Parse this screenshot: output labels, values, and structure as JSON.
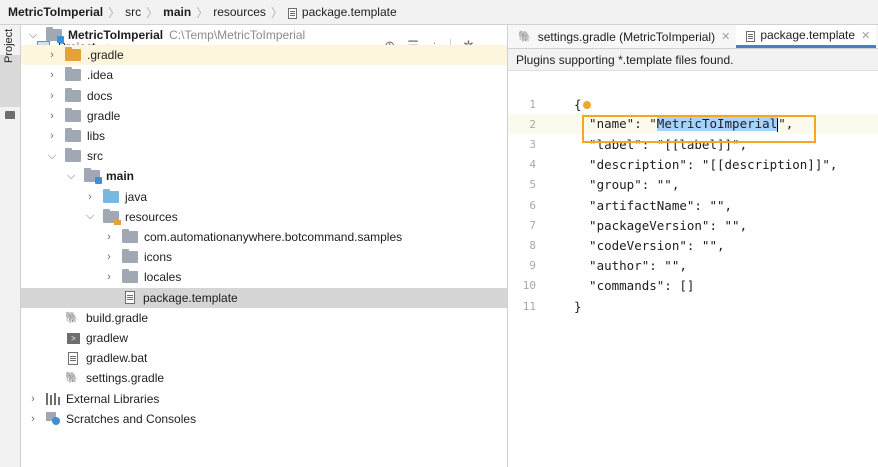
{
  "breadcrumb": [
    "MetricToImperial",
    "src",
    "main",
    "resources",
    "package.template"
  ],
  "toolstrip": {
    "label": "Project"
  },
  "project_panel": {
    "title": "Project"
  },
  "tree": [
    {
      "label": "MetricToImperial",
      "hint": "C:\\Temp\\MetricToImperial",
      "icon": "module",
      "arrow": "down",
      "indent": 0,
      "bold": true
    },
    {
      "label": ".gradle",
      "icon": "orange",
      "arrow": "right",
      "indent": 1,
      "highlight": "yellow"
    },
    {
      "label": ".idea",
      "icon": "folder",
      "arrow": "right",
      "indent": 1
    },
    {
      "label": "docs",
      "icon": "folder",
      "arrow": "right",
      "indent": 1
    },
    {
      "label": "gradle",
      "icon": "folder",
      "arrow": "right",
      "indent": 1
    },
    {
      "label": "libs",
      "icon": "folder",
      "arrow": "right",
      "indent": 1
    },
    {
      "label": "src",
      "icon": "folder",
      "arrow": "down",
      "indent": 1
    },
    {
      "label": "main",
      "icon": "module",
      "arrow": "down",
      "indent": 2,
      "bold": true
    },
    {
      "label": "java",
      "icon": "blue",
      "arrow": "right",
      "indent": 3
    },
    {
      "label": "resources",
      "icon": "res",
      "arrow": "down",
      "indent": 3
    },
    {
      "label": "com.automationanywhere.botcommand.samples",
      "icon": "folder",
      "arrow": "right",
      "indent": 4
    },
    {
      "label": "icons",
      "icon": "folder",
      "arrow": "right",
      "indent": 4
    },
    {
      "label": "locales",
      "icon": "folder",
      "arrow": "right",
      "indent": 4
    },
    {
      "label": "package.template",
      "icon": "file",
      "arrow": "none",
      "indent": 4,
      "highlight": "gray"
    },
    {
      "label": "build.gradle",
      "icon": "gradle",
      "arrow": "none",
      "indent": 1
    },
    {
      "label": "gradlew",
      "icon": "term",
      "arrow": "none",
      "indent": 1
    },
    {
      "label": "gradlew.bat",
      "icon": "file",
      "arrow": "none",
      "indent": 1
    },
    {
      "label": "settings.gradle",
      "icon": "gradle",
      "arrow": "none",
      "indent": 1
    },
    {
      "label": "External Libraries",
      "icon": "lib",
      "arrow": "right",
      "indent": 0
    },
    {
      "label": "Scratches and Consoles",
      "icon": "scratch",
      "arrow": "right",
      "indent": 0
    }
  ],
  "editor": {
    "tabs": [
      {
        "label": "settings.gradle (MetricToImperial)",
        "active": false
      },
      {
        "label": "package.template",
        "active": true
      }
    ],
    "banner": "Plugins supporting *.template files found.",
    "lines": [
      {
        "num": "1",
        "text": "{"
      },
      {
        "num": "2",
        "pre": "  \"name\": \"",
        "selected": "MetricToImperia",
        "tail": "l",
        "post": "\","
      },
      {
        "num": "3",
        "text": "  \"label\": \"[[label]]\","
      },
      {
        "num": "4",
        "text": "  \"description\": \"[[description]]\","
      },
      {
        "num": "5",
        "text": "  \"group\": \"\","
      },
      {
        "num": "6",
        "text": "  \"artifactName\": \"\","
      },
      {
        "num": "7",
        "text": "  \"packageVersion\": \"\","
      },
      {
        "num": "8",
        "text": "  \"codeVersion\": \"\","
      },
      {
        "num": "9",
        "text": "  \"author\": \"\","
      },
      {
        "num": "10",
        "text": "  \"commands\": []"
      },
      {
        "num": "11",
        "text": "}"
      }
    ]
  }
}
